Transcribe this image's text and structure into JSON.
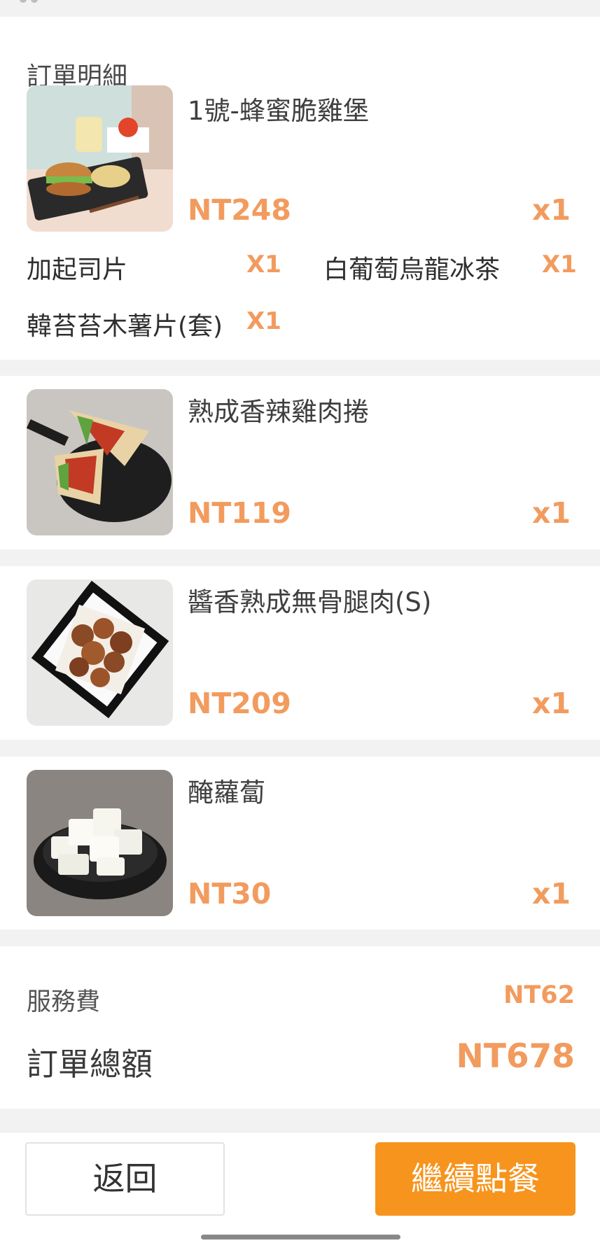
{
  "order": {
    "section_title": "訂單明細",
    "items": [
      {
        "name": "1號-蜂蜜脆雞堡",
        "price": "NT248",
        "qty": "x1",
        "addons": [
          {
            "label": "加起司片",
            "qty": "X1"
          },
          {
            "label": "白葡萄烏龍冰茶",
            "qty": "X1"
          },
          {
            "label": "韓苔苔木薯片(套)",
            "qty": "X1"
          }
        ]
      },
      {
        "name": "熟成香辣雞肉捲",
        "price": "NT119",
        "qty": "x1"
      },
      {
        "name": "醬香熟成無骨腿肉(S)",
        "price": "NT209",
        "qty": "x1"
      },
      {
        "name": "醃蘿蔔",
        "price": "NT30",
        "qty": "x1"
      }
    ]
  },
  "summary": {
    "service_fee_label": "服務費",
    "service_fee_value": "NT62",
    "total_label": "訂單總額",
    "total_value": "NT678"
  },
  "footer": {
    "back_label": "返回",
    "continue_label": "繼續點餐"
  },
  "colors": {
    "accent": "#f29b5e",
    "button_orange": "#f7941d"
  }
}
